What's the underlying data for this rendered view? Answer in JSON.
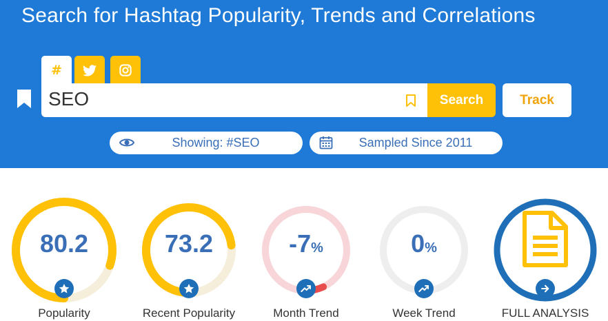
{
  "header": {
    "title": "Search for Hashtag Popularity, Trends and Correlations"
  },
  "tabs": [
    {
      "name": "hashtag",
      "icon": "hash-icon",
      "glyph": "#",
      "active": true
    },
    {
      "name": "twitter",
      "icon": "twitter-icon",
      "active": false
    },
    {
      "name": "instagram",
      "icon": "instagram-icon",
      "active": false
    }
  ],
  "search": {
    "value": "SEO",
    "button_label": "Search",
    "track_label": "Track"
  },
  "info": {
    "showing": "Showing: #SEO",
    "sampled": "Sampled Since 2011"
  },
  "stats": {
    "popularity": {
      "value": "80.2",
      "label": "Popularity",
      "fill": 0.802,
      "icon": "star-icon"
    },
    "recent": {
      "value": "73.2",
      "label": "Recent Popularity",
      "fill": 0.732,
      "icon": "star-icon"
    },
    "month": {
      "value": "-7",
      "unit": "%",
      "label": "Month Trend",
      "fill": 0.07,
      "icon": "trend-icon"
    },
    "week": {
      "value": "0",
      "unit": "%",
      "label": "Week Trend",
      "fill": 0,
      "icon": "trend-icon"
    },
    "analysis": {
      "label": "FULL ANALYSIS",
      "icon": "document-icon"
    }
  },
  "colors": {
    "header_blue": "#1E7AD6",
    "accent_yellow": "#FFC107",
    "text_blue": "#3A6FB7",
    "badge_blue": "#1E6FB8",
    "trend_negative": "#E84C4C"
  }
}
